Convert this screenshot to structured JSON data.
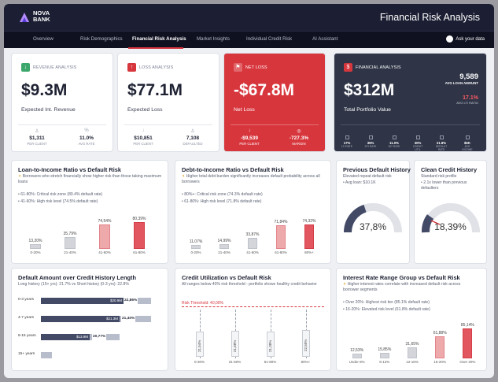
{
  "header": {
    "brand_line1": "NOVA",
    "brand_line2": "BANK",
    "title": "Financial Risk Analysis"
  },
  "nav": {
    "tabs": [
      "Overview",
      "Risk Demographics",
      "Financial Risk Analysis",
      "Market Insights",
      "Individual Credit Risk",
      "AI Assistant"
    ],
    "active": "Financial Risk Analysis",
    "ask": "Ask your data"
  },
  "colors": {
    "accent": "#d7363d",
    "dark": "#2f3547",
    "navy": "#1c1f33"
  },
  "kpi": [
    {
      "tag": "REVENUE ANALYSIS",
      "icon": "arrow-down-icon",
      "value": "$9.3M",
      "sub": "Expected Int. Revenue",
      "stats": [
        {
          "icon": "users-icon",
          "value": "$1,311",
          "label": "PER CLIENT"
        },
        {
          "icon": "percent-icon",
          "value": "11.0%",
          "label": "AVG RATE"
        }
      ]
    },
    {
      "tag": "LOSS ANALYSIS",
      "icon": "arrow-up-icon",
      "value": "$77.1M",
      "sub": "Expected Loss",
      "stats": [
        {
          "icon": "down-icon",
          "value": "$10,851",
          "label": "PER CLIENT"
        },
        {
          "icon": "people-icon",
          "value": "7,108",
          "label": "DEFAULTED"
        }
      ]
    },
    {
      "tag": "NET LOSS",
      "icon": "flag-icon",
      "value": "-$67.8M",
      "sub": "Net Loss",
      "stats": [
        {
          "icon": "down-icon",
          "value": "-$9,539",
          "label": "PER CLIENT"
        },
        {
          "icon": "target-icon",
          "value": "-727.3%",
          "label": "MARGIN"
        }
      ]
    },
    {
      "tag": "FINANCIAL ANALYSIS",
      "icon": "dollar-icon",
      "value": "$312M",
      "sub": "Total Portfolio Value",
      "side1_value": "9,589",
      "side1_label": "AVG LOAN AMOUNT",
      "side2_value": "17.1%",
      "side2_label": "AVG LTI RATIO",
      "minis": [
        {
          "value": "17%",
          "label": "LTI RATE"
        },
        {
          "value": "35%",
          "label": "DTI RATE"
        },
        {
          "value": "11.0%",
          "label": "INT RATE"
        },
        {
          "value": "30%",
          "label": "CREDIT UTIL"
        },
        {
          "value": "21.8%",
          "label": "DEFAULT RATE"
        },
        {
          "value": "$6K",
          "label": "AVG INCOME"
        }
      ]
    }
  ],
  "lti": {
    "title": "Loan-to-Income Ratio vs Default Risk",
    "desc": "Borrowers who stretch financially show higher risk than those taking maximum loans",
    "bullets": [
      "61-80%: Critical risk zone (80.4% default rate)",
      "41-60%: High risk level (74.5% default rate)"
    ]
  },
  "dti": {
    "title": "Debt-to-Income Ratio vs Default Risk",
    "desc": "Higher total debt burden significantly increases default probability across all borrowers",
    "bullets": [
      "80%+: Critical risk zone (74.3% default rate)",
      "61-80%: High risk level (71.8% default rate)"
    ]
  },
  "prev": {
    "title": "Previous Default History",
    "desc1": "Elevated repeat default risk",
    "desc2": "Avg loan: $10.1K",
    "value": "37,8%"
  },
  "clean": {
    "title": "Clean Credit History",
    "desc1": "Standard risk profile",
    "desc2": "2.1x lower than previous defaulters",
    "value": "18,39%"
  },
  "hist": {
    "title": "Default Amount over Credit History Length",
    "desc": "Long history (15+ yrs): 21.7% vs Short history (0-3 yrs): 22.8%",
    "rows": [
      {
        "label": "0-3 years",
        "amount": "$20.9M",
        "pct": "22,86%"
      },
      {
        "label": "4-7 years",
        "amount": "$21.3M",
        "pct": "21,40%"
      },
      {
        "label": "8-15 years",
        "amount": "$13.9M",
        "pct": "20,77%"
      },
      {
        "label": "15+ years",
        "amount": "",
        "pct": ""
      }
    ]
  },
  "util": {
    "title": "Credit Utilization vs Default Risk",
    "desc": "All ranges below 40% risk threshold - portfolio shows healthy credit behavior",
    "threshold": "Risk Threshold: 40,00%"
  },
  "irate": {
    "title": "Interest Rate Range Group vs Default Risk",
    "desc": "Higher interest rates correlate with increased default risk across borrower segments",
    "bullets": [
      "Over 20%: Highest risk tier (85.1% default rate)",
      "16-20%: Elevated risk level (61.8% default rate)"
    ]
  },
  "chart_data": [
    {
      "type": "bar",
      "title": "Loan-to-Income Ratio vs Default Risk",
      "categories": [
        "0-20%",
        "21-40%",
        "41-60%",
        "61-80%"
      ],
      "values": [
        13.2,
        35.79,
        74.54,
        80.39
      ],
      "labels": [
        "13,20%",
        "35,79%",
        "74,54%",
        "80,39%"
      ]
    },
    {
      "type": "bar",
      "title": "Debt-to-Income Ratio vs Default Risk",
      "categories": [
        "0-20%",
        "21-40%",
        "41-60%",
        "61-80%",
        "80%+"
      ],
      "values": [
        11.07,
        14.99,
        33.87,
        71.84,
        74.32
      ],
      "labels": [
        "11,07%",
        "14,99%",
        "33,87%",
        "71,84%",
        "74,32%"
      ]
    },
    {
      "type": "bar",
      "title": "Credit Utilization vs Default Risk",
      "categories": [
        "0-30%",
        "31-50%",
        "51-80%",
        "80%+"
      ],
      "values": [
        21.54,
        21.68,
        21.38,
        22.5
      ],
      "labels": [
        "21,54%",
        "21,68%",
        "21,38%",
        "22,50%"
      ],
      "threshold": 40
    },
    {
      "type": "bar",
      "title": "Interest Rate Range Group vs Default Risk",
      "categories": [
        "Under 8%",
        "8-12%",
        "12-16%",
        "16-20%",
        "Over 20%"
      ],
      "values": [
        12.53,
        15.85,
        31.65,
        61.88,
        85.14
      ],
      "labels": [
        "12,53%",
        "15,85%",
        "31,65%",
        "61,88%",
        "85,14%"
      ]
    },
    {
      "type": "bar",
      "title": "Default Amount over Credit History Length",
      "categories": [
        "0-3 years",
        "4-7 years",
        "8-15 years",
        "15+ years"
      ],
      "values": [
        22.86,
        21.4,
        20.77,
        null
      ]
    }
  ]
}
